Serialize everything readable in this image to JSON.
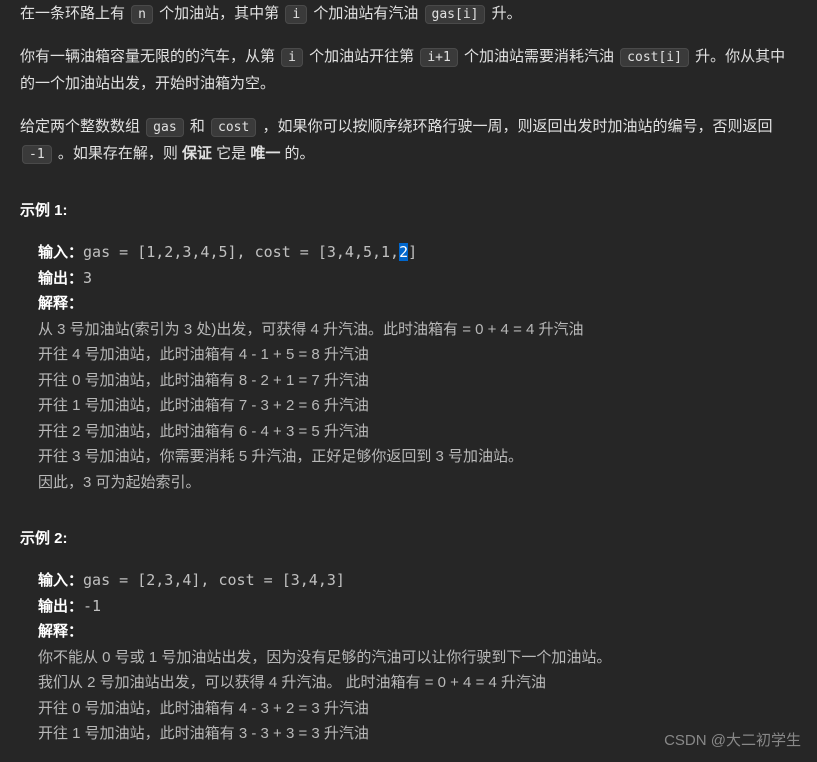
{
  "intro": {
    "p1_a": "在一条环路上有 ",
    "p1_code1": "n",
    "p1_b": " 个加油站，其中第 ",
    "p1_code2": "i",
    "p1_c": " 个加油站有汽油 ",
    "p1_code3": "gas[i]",
    "p1_d": " 升。",
    "p2_a": "你有一辆油箱容量无限的的汽车，从第 ",
    "p2_code1": "i",
    "p2_b": " 个加油站开往第 ",
    "p2_code2": "i+1",
    "p2_c": " 个加油站需要消耗汽油 ",
    "p2_code3": "cost[i]",
    "p2_d": " 升。你从其中的一个加油站出发，开始时油箱为空。",
    "p3_a": "给定两个整数数组 ",
    "p3_code1": "gas",
    "p3_b": " 和 ",
    "p3_code2": "cost",
    "p3_c": " ，如果你可以按顺序绕环路行驶一周，则返回出发时加油站的编号，否则返回 ",
    "p3_code3": "-1",
    "p3_d": " 。如果存在解，则 ",
    "p3_bold1": "保证",
    "p3_e": " 它是 ",
    "p3_bold2": "唯一",
    "p3_f": " 的。"
  },
  "ex1": {
    "heading": "示例 1:",
    "input_label": "输入：",
    "input_a": "gas = [1,2,3,4,5], cost = [3,4,5,1,",
    "input_sel": "2",
    "input_b": "]",
    "output_label": "输出：",
    "output_val": "3",
    "explain_label": "解释：",
    "lines": [
      "从 3 号加油站(索引为 3 处)出发，可获得 4 升汽油。此时油箱有 = 0 + 4 = 4 升汽油",
      "开往 4 号加油站，此时油箱有 4 - 1 + 5 = 8 升汽油",
      "开往 0 号加油站，此时油箱有 8 - 2 + 1 = 7 升汽油",
      "开往 1 号加油站，此时油箱有 7 - 3 + 2 = 6 升汽油",
      "开往 2 号加油站，此时油箱有 6 - 4 + 3 = 5 升汽油",
      "开往 3 号加油站，你需要消耗 5 升汽油，正好足够你返回到 3 号加油站。",
      "因此，3 可为起始索引。"
    ]
  },
  "ex2": {
    "heading": "示例 2:",
    "input_label": "输入：",
    "input_val": "gas = [2,3,4], cost = [3,4,3]",
    "output_label": "输出：",
    "output_val": "-1",
    "explain_label": "解释：",
    "lines": [
      "你不能从 0 号或 1 号加油站出发，因为没有足够的汽油可以让你行驶到下一个加油站。",
      "我们从 2 号加油站出发，可以获得 4 升汽油。 此时油箱有 = 0 + 4 = 4 升汽油",
      "开往 0 号加油站，此时油箱有 4 - 3 + 2 = 3 升汽油",
      "开往 1 号加油站，此时油箱有 3 - 3 + 3 = 3 升汽油"
    ]
  },
  "watermark": "CSDN @大二初学生"
}
